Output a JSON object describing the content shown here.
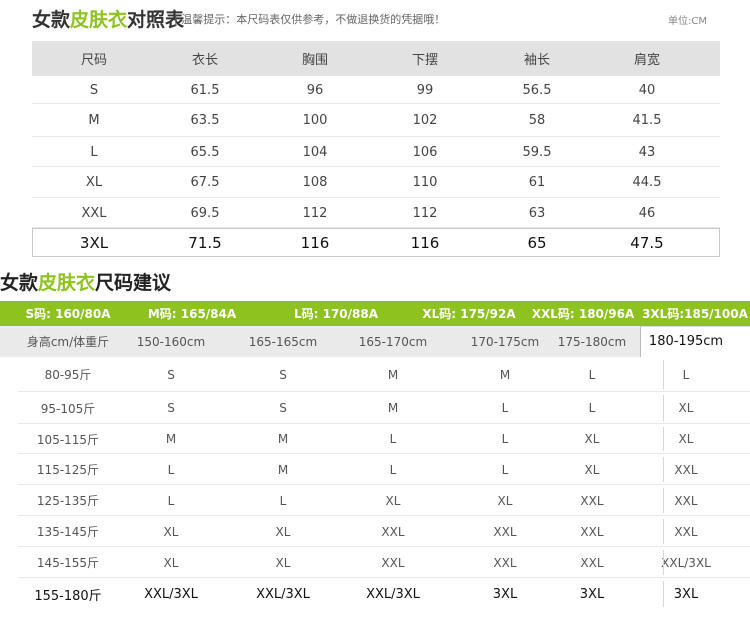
{
  "chart1": {
    "title_prefix": "女款",
    "title_highlight": "皮肤衣",
    "title_suffix": "对照表",
    "tip": "| 温馨提示：本尺码表仅供参考，不做退换货的凭据哦！",
    "unit": "单位:CM",
    "headers": [
      "尺码",
      "衣长",
      "胸围",
      "下摆",
      "袖长",
      "肩宽"
    ],
    "rows": [
      [
        "S",
        "61.5",
        "96",
        "99",
        "56.5",
        "40"
      ],
      [
        "M",
        "63.5",
        "100",
        "102",
        "58",
        "41.5"
      ],
      [
        "L",
        "65.5",
        "104",
        "106",
        "59.5",
        "43"
      ],
      [
        "XL",
        "67.5",
        "108",
        "110",
        "61",
        "44.5"
      ],
      [
        "XXL",
        "69.5",
        "112",
        "112",
        "63",
        "46"
      ],
      [
        "3XL",
        "71.5",
        "116",
        "116",
        "65",
        "47.5"
      ]
    ]
  },
  "chart2": {
    "title_prefix": "女款",
    "title_highlight": "皮肤衣",
    "title_suffix": "尺码建议",
    "band": [
      "S码: 160/80A",
      "M码: 165/84A",
      "L码: 170/88A",
      "XL码: 175/92A",
      "XXL码: 180/96A",
      "3XL码:185/100A"
    ],
    "subheader": [
      "身高cm/体重斤",
      "150-160cm",
      "165-165cm",
      "165-170cm",
      "170-175cm",
      "175-180cm",
      "180-195cm"
    ],
    "rows": [
      [
        "80-95斤",
        "S",
        "S",
        "M",
        "M",
        "L",
        "L"
      ],
      [
        "95-105斤",
        "S",
        "S",
        "M",
        "L",
        "L",
        "XL"
      ],
      [
        "105-115斤",
        "M",
        "M",
        "L",
        "L",
        "XL",
        "XL"
      ],
      [
        "115-125斤",
        "L",
        "M",
        "L",
        "L",
        "XL",
        "XXL"
      ],
      [
        "125-135斤",
        "L",
        "L",
        "XL",
        "XL",
        "XXL",
        "XXL"
      ],
      [
        "135-145斤",
        "XL",
        "XL",
        "XXL",
        "XXL",
        "XXL",
        "XXL"
      ],
      [
        "145-155斤",
        "XL",
        "XL",
        "XXL",
        "XXL",
        "XXL",
        "XXL/3XL"
      ],
      [
        "155-180斤",
        "XXL/3XL",
        "XXL/3XL",
        "XXL/3XL",
        "3XL",
        "3XL",
        "3XL"
      ]
    ]
  },
  "colors": {
    "accent": "#8dc21f",
    "header_bg": "#e2e2e2",
    "text": "#333333"
  }
}
